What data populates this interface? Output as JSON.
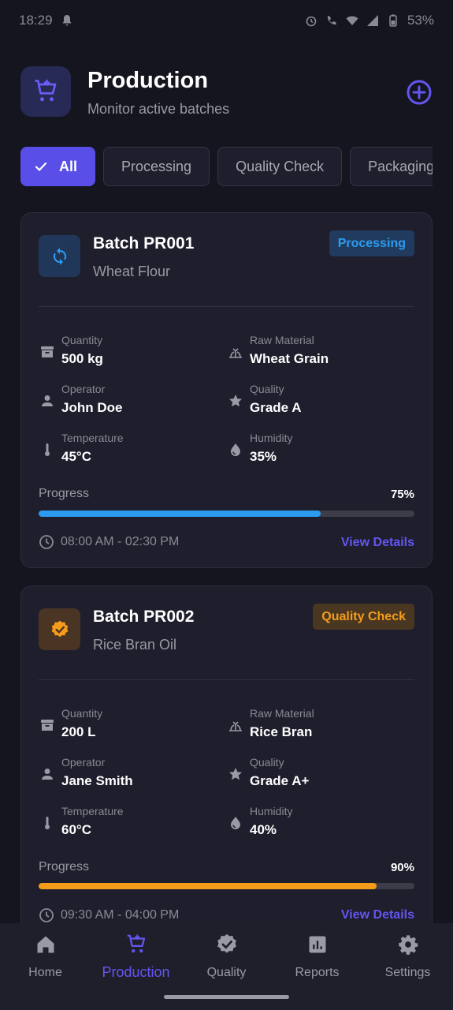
{
  "status_bar": {
    "time": "18:29",
    "battery": "53%"
  },
  "header": {
    "title": "Production",
    "subtitle": "Monitor active batches",
    "app_icon": "cart-icon",
    "add_icon": "add-circle-icon"
  },
  "filters": {
    "chips": [
      {
        "label": "All",
        "active": true
      },
      {
        "label": "Processing",
        "active": false
      },
      {
        "label": "Quality Check",
        "active": false
      },
      {
        "label": "Packaging",
        "active": false
      }
    ]
  },
  "batches": [
    {
      "name": "Batch PR001",
      "product": "Wheat Flour",
      "status": "Processing",
      "status_color": "#2c9bef",
      "status_bg": "#213b5e",
      "icon": "sync-icon",
      "icon_bg": "#21375a",
      "quantity_label": "Quantity",
      "quantity": "500 kg",
      "raw_material_label": "Raw Material",
      "raw_material": "Wheat Grain",
      "operator_label": "Operator",
      "operator": "John Doe",
      "quality_label": "Quality",
      "quality": "Grade A",
      "temperature_label": "Temperature",
      "temperature": "45°C",
      "humidity_label": "Humidity",
      "humidity": "35%",
      "progress_label": "Progress",
      "progress_text": "75%",
      "progress": 0.75,
      "progress_color": "#2c9bef",
      "time_range": "08:00 AM - 02:30 PM",
      "view_details": "View Details"
    },
    {
      "name": "Batch PR002",
      "product": "Rice Bran Oil",
      "status": "Quality Check",
      "status_color": "#f59c1a",
      "status_bg": "#4a3722",
      "icon": "verified-icon",
      "icon_bg": "#4a3424",
      "quantity_label": "Quantity",
      "quantity": "200 L",
      "raw_material_label": "Raw Material",
      "raw_material": "Rice Bran",
      "operator_label": "Operator",
      "operator": "Jane Smith",
      "quality_label": "Quality",
      "quality": "Grade A+",
      "temperature_label": "Temperature",
      "temperature": "60°C",
      "humidity_label": "Humidity",
      "humidity": "40%",
      "progress_label": "Progress",
      "progress_text": "90%",
      "progress": 0.9,
      "progress_color": "#f59c1a",
      "time_range": "09:30 AM - 04:00 PM",
      "view_details": "View Details"
    }
  ],
  "bottom_nav": [
    {
      "label": "Home",
      "icon": "home-icon",
      "active": false
    },
    {
      "label": "Production",
      "icon": "cart-icon",
      "active": true
    },
    {
      "label": "Quality",
      "icon": "verified-icon",
      "active": false
    },
    {
      "label": "Reports",
      "icon": "chart-icon",
      "active": false
    },
    {
      "label": "Settings",
      "icon": "gear-icon",
      "active": false
    }
  ],
  "colors": {
    "accent": "#5a4ee8",
    "background": "#15151f",
    "card": "#1e1e2c"
  }
}
